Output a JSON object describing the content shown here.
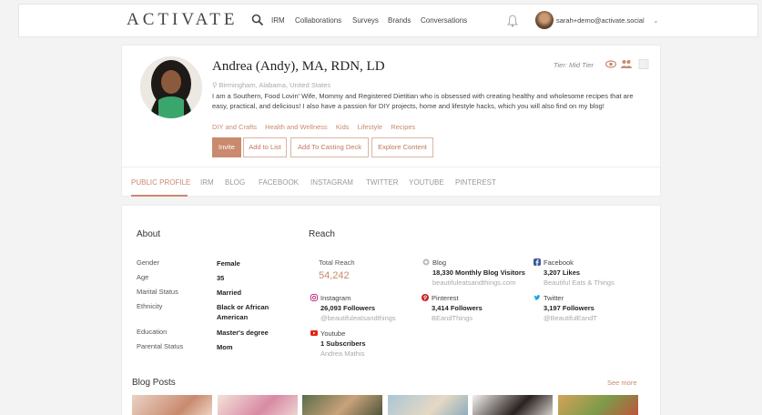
{
  "app": {
    "logo": "ACTIVATE",
    "nav": [
      "IRM",
      "Collaborations",
      "Surveys",
      "Brands",
      "Conversations"
    ],
    "user_email": "sarah+demo@activate.social",
    "chevron": "⌄"
  },
  "profile": {
    "name": "Andrea (Andy), MA, RDN, LD",
    "tier": "Tier: Mid Tier",
    "location": "Birmingham, Alabama, United States",
    "bio": "I am a Southern, Food Lovin' Wife, Mommy and Registered Dietitian who is obsessed with creating healthy and wholesome recipes that are easy, practical, and delicious! I also have a passion for DIY projects, home and lifestyle hacks, which you will also find on my blog!",
    "tags": [
      "DIY and Crafts",
      "Health and Wellness",
      "Kids",
      "Lifestyle",
      "Recipes"
    ],
    "buttons": {
      "invite": "Invite",
      "add_list": "Add to List",
      "add_casting": "Add To Casting Deck",
      "explore": "Explore Content"
    },
    "tabs": [
      "PUBLIC PROFILE",
      "IRM",
      "BLOG",
      "FACEBOOK",
      "INSTAGRAM",
      "TWITTER",
      "YOUTUBE",
      "PINTEREST"
    ]
  },
  "about": {
    "title": "About",
    "rows": [
      {
        "label": "Gender",
        "value": "Female"
      },
      {
        "label": "Age",
        "value": "35"
      },
      {
        "label": "Marital Status",
        "value": "Married"
      },
      {
        "label": "Ethnicity",
        "value": "Black or African American"
      },
      {
        "label": "Education",
        "value": "Master's degree"
      },
      {
        "label": "Parental Status",
        "value": "Mom"
      }
    ]
  },
  "reach": {
    "title": "Reach",
    "total_label": "Total Reach",
    "total_value": "54,242",
    "blog": {
      "title": "Blog",
      "stat": "18,330 Monthly Blog Visitors",
      "handle": "beautifuleatsandthings.com"
    },
    "facebook": {
      "title": "Facebook",
      "stat": "3,207 Likes",
      "handle": "Beautiful Eats & Things"
    },
    "instagram": {
      "title": "Instagram",
      "stat": "26,093 Followers",
      "handle": "@beautifuleatsandthings"
    },
    "pinterest": {
      "title": "Pinterest",
      "stat": "3,414 Followers",
      "handle": "BEandThings"
    },
    "twitter": {
      "title": "Twitter",
      "stat": "3,197 Followers",
      "handle": "@BeautifulEandT"
    },
    "youtube": {
      "title": "Youtube",
      "stat": "1 Subscribers",
      "handle": "Andrea Mathis"
    }
  },
  "blog_posts": {
    "title": "Blog Posts",
    "see_more": "See more"
  },
  "colors": {
    "accent": "#c98a6e",
    "instagram": "#c13584",
    "pinterest": "#cb2027",
    "twitter": "#1da1f2",
    "facebook": "#3b5998",
    "youtube": "#e62117"
  }
}
